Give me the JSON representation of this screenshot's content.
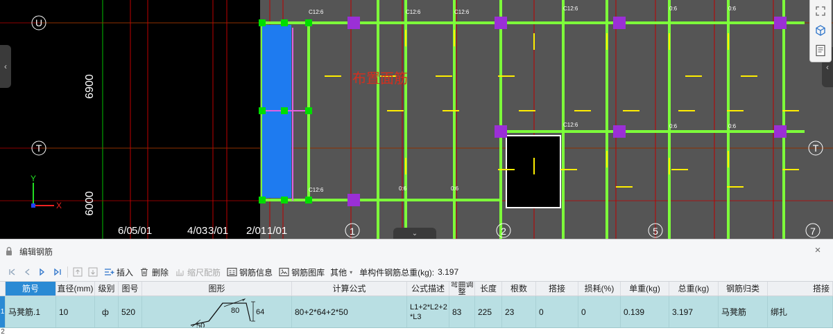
{
  "viewport": {
    "axis_labels": {
      "row_u": "U",
      "row_t": "T",
      "col_1": "1",
      "col_2": "2",
      "col_5": "5",
      "col_7": "7"
    },
    "dimensions": {
      "upper": "6900",
      "lower": "6000"
    },
    "bottom_labels": [
      "6/0",
      "5/01",
      "4/03",
      "3/01",
      "2/01",
      "1/01"
    ],
    "canvas_label": "布置面筋",
    "rebar_tags": {
      "c12": "C12:6",
      "small": "0:6"
    },
    "ucs": {
      "x": "X",
      "y": "Y"
    },
    "colors": {
      "background": "#000000",
      "slab": "#555555",
      "grid_red": "#c00000",
      "grid_green": "#00c000",
      "beam_green": "#7dff3a",
      "rebar_yellow": "#ffee00",
      "column_purple": "#9b2fd6",
      "highlight_blue": "#1e7bf0",
      "label_red": "#d23020"
    },
    "icons": [
      "chevron-left-icon",
      "chevron-right-icon",
      "chevron-down-icon",
      "cube-icon",
      "properties-icon",
      "fit-view-icon"
    ]
  },
  "panel": {
    "title": "编辑钢筋",
    "close_label": "×",
    "toolbar": {
      "insert": "插入",
      "delete": "删除",
      "scale_rebar": "缩尺配筋",
      "rebar_info": "钢筋信息",
      "rebar_library": "钢筋图库",
      "other": "其他",
      "total_weight_label": "单构件钢筋总重(kg):",
      "total_weight_value": "3.197"
    },
    "columns": [
      "筋号",
      "直径(mm)",
      "级别",
      "图号",
      "图形",
      "计算公式",
      "公式描述",
      "弯曲调整",
      "长度",
      "根数",
      "搭接",
      "损耗(%)",
      "单重(kg)",
      "总重(kg)",
      "钢筋归类",
      "搭接"
    ],
    "rows": [
      {
        "index": "1",
        "bar_no": "马凳筋.1",
        "diameter": "10",
        "grade": "ф",
        "shape_no": "520",
        "shape_dims": {
          "top": "80",
          "height": "64",
          "leg": "50"
        },
        "formula": "80+2*64+2*50",
        "formula_desc_line1": "L1+2*L2+2",
        "formula_desc_line2": "*L3",
        "bend_adjust": "83",
        "length": "225",
        "count": "23",
        "lap": "0",
        "loss": "0",
        "unit_weight": "0.139",
        "total_weight": "3.197",
        "category": "马凳筋",
        "lap_type": "绑扎"
      }
    ],
    "next_row_index": "2"
  }
}
